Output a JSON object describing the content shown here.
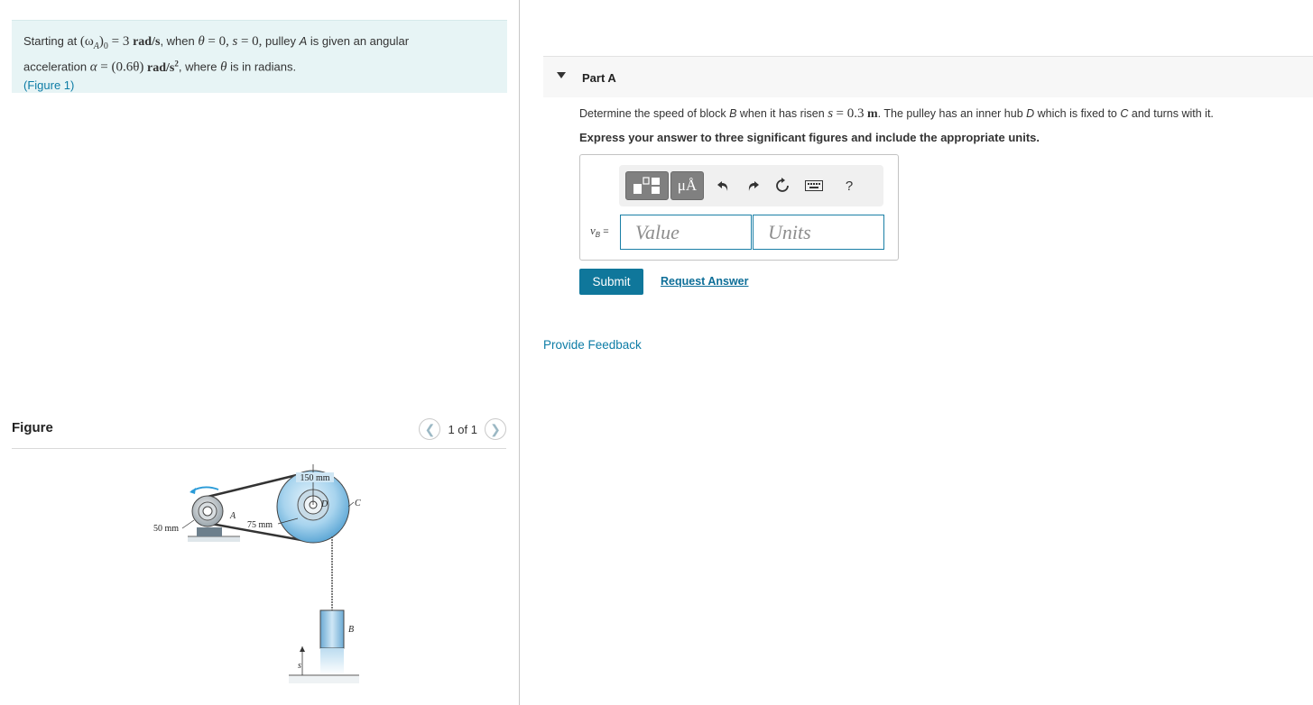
{
  "problem": {
    "text_start": "Starting at",
    "omega_expr": "(ω",
    "omega_sub": "A",
    "omega_close": ")",
    "omega_sub0": "0",
    "omega_value": "= 3",
    "omega_units": "rad/s",
    "text_when": ", when",
    "theta_sym": "θ",
    "theta_value": "= 0,",
    "s_sym": "s",
    "s_value": "= 0,",
    "text_pulley": ", pulley",
    "pulley_name": "A",
    "text_given": "is given an angular",
    "text_accel": "acceleration",
    "alpha_sym": "α",
    "alpha_value": "= (0.6θ)",
    "alpha_units": "rad/s",
    "alpha_exp": "2",
    "text_where": ", where",
    "text_radians": "is in radians.",
    "figure_link": "(Figure 1)"
  },
  "figure": {
    "title": "Figure",
    "pager_text": "1 of 1",
    "prev_icon": "chevron-left-icon",
    "next_icon": "chevron-right-icon",
    "labels": {
      "d150": "150 mm",
      "d75": "75 mm",
      "d50": "50 mm",
      "A": "A",
      "C": "C",
      "D": "D",
      "B": "B",
      "s": "s"
    }
  },
  "part_a": {
    "title": "Part A",
    "question_pre": "Determine the speed of block",
    "block": "B",
    "question_mid": "when it has risen",
    "s_sym": "s",
    "s_value": "= 0.3",
    "s_units": "m",
    "question_post1": ". The pulley has an inner hub",
    "hub": "D",
    "question_post2": "which is fixed to",
    "fixed_to": "C",
    "question_post3": "and turns with it.",
    "instruction": "Express your answer to three significant figures and include the appropriate units.",
    "toolbar": {
      "templates_icon": "templates-icon",
      "units_label": "μÅ",
      "undo_icon": "undo-icon",
      "redo_icon": "redo-icon",
      "reset_icon": "reset-icon",
      "keyboard_icon": "keyboard-icon",
      "help_label": "?"
    },
    "var_label": "v",
    "var_sub": "B",
    "var_eq": "=",
    "value_placeholder": "Value",
    "units_placeholder": "Units",
    "submit_label": "Submit",
    "request_answer_label": "Request Answer"
  },
  "feedback_label": "Provide Feedback"
}
